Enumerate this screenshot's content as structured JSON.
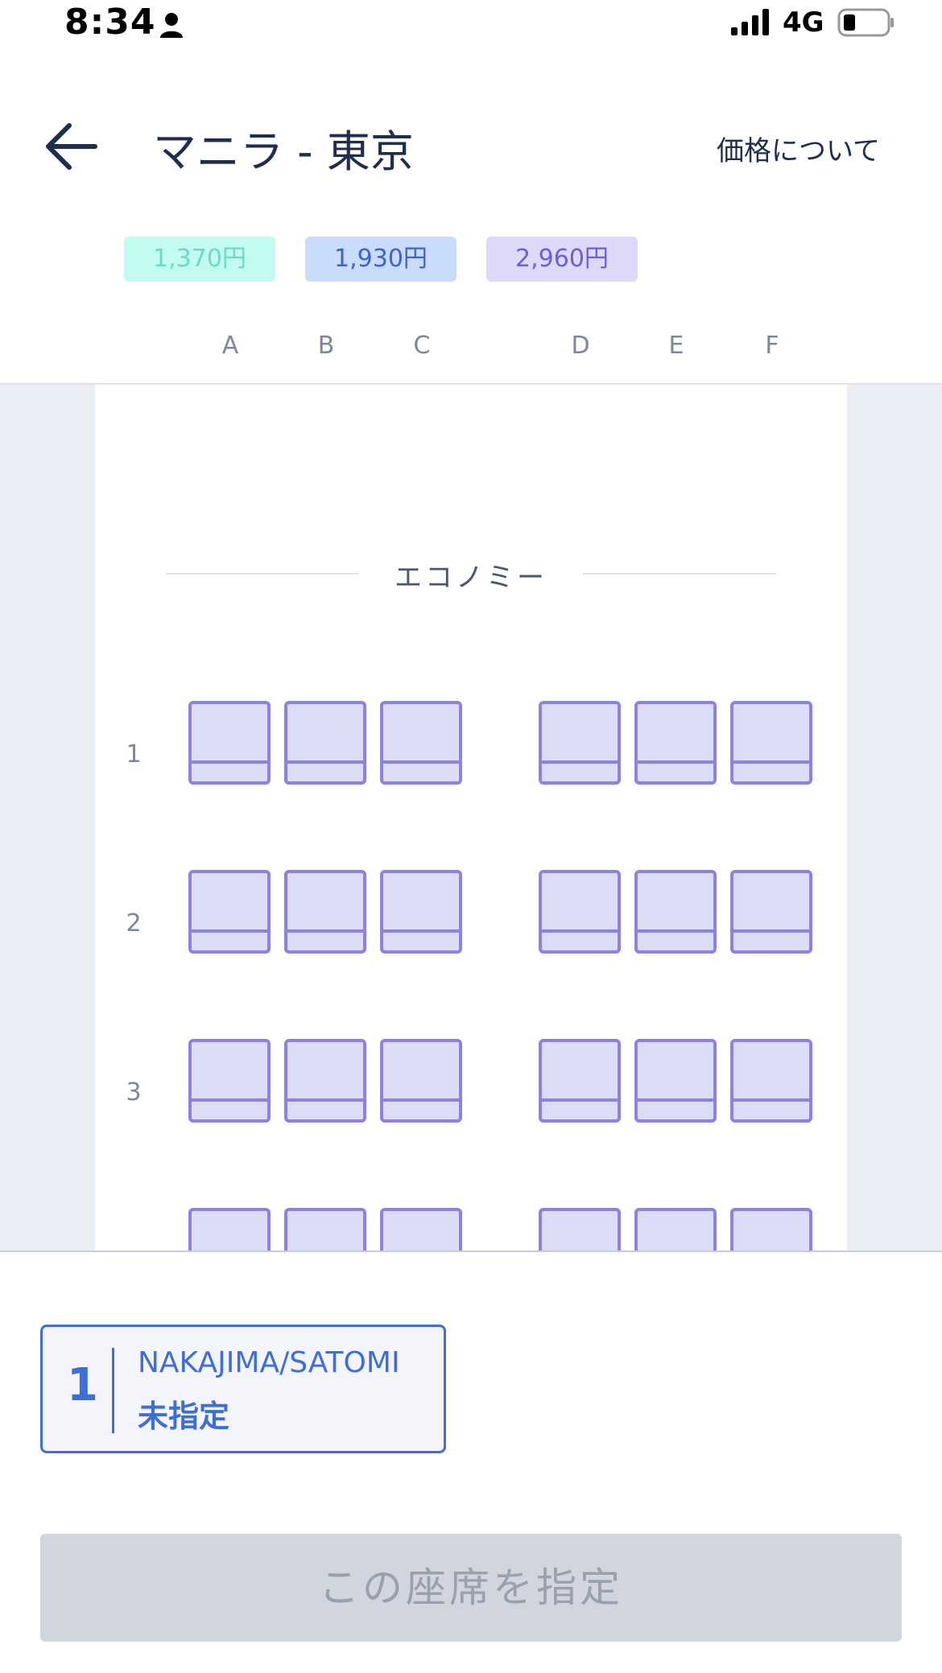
{
  "status_bar": {
    "time": "8:34",
    "network": "4G",
    "icons": [
      "person-icon",
      "signal-icon",
      "battery-icon"
    ]
  },
  "header": {
    "back_icon": "arrow-left-icon",
    "title": "マニラ - 東京",
    "price_info_link": "価格について"
  },
  "price_legend": [
    {
      "label": "1,370円",
      "color": "#c3fbf1"
    },
    {
      "label": "1,930円",
      "color": "#c9dcfb"
    },
    {
      "label": "2,960円",
      "color": "#dcdaf8"
    }
  ],
  "columns": [
    "A",
    "B",
    "C",
    "D",
    "E",
    "F"
  ],
  "cabin": {
    "label": "エコノミー",
    "rows": [
      "1",
      "2",
      "3"
    ]
  },
  "passenger": {
    "number": "1",
    "name": "NAKAJIMA/SATOMI",
    "seat_status": "未指定"
  },
  "confirm_button": {
    "label": "この座席を指定",
    "enabled": false
  },
  "colors": {
    "accent": "#3f6fd6",
    "seat_fill": "#dddcf7",
    "seat_border": "#8b82e3",
    "disabled_button": "#d1d5dd"
  }
}
